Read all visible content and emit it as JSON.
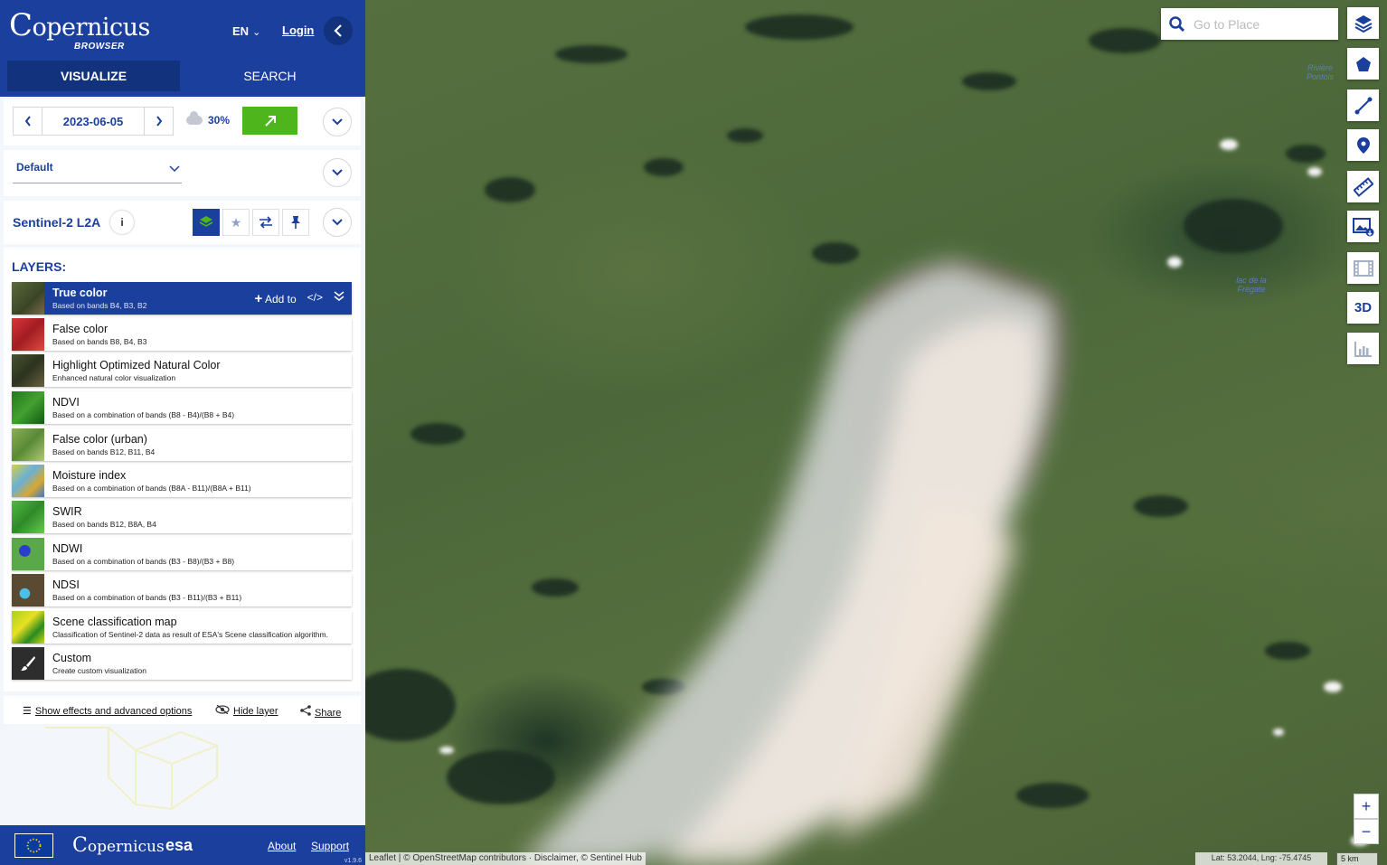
{
  "header": {
    "logo_text": "opernicus",
    "logo_sub": "BROWSER",
    "language": "EN",
    "login_label": "Login",
    "tabs": [
      {
        "label": "VISUALIZE",
        "active": true
      },
      {
        "label": "SEARCH",
        "active": false
      }
    ]
  },
  "date_row": {
    "date": "2023-06-05",
    "cloud_cover": "30%"
  },
  "theme": {
    "selected": "Default"
  },
  "collection": {
    "title": "Sentinel-2 L2A"
  },
  "layers": {
    "heading": "LAYERS:",
    "add_to_label": "Add to",
    "items": [
      {
        "name": "True color",
        "desc": "Based on bands B4, B3, B2",
        "active": true,
        "thumb": "#4a5a30"
      },
      {
        "name": "False color",
        "desc": "Based on bands B8, B4, B3",
        "active": false,
        "thumb": "#c0262a"
      },
      {
        "name": "Highlight Optimized Natural Color",
        "desc": "Enhanced natural color visualization",
        "active": false,
        "thumb": "#3e4a2c"
      },
      {
        "name": "NDVI",
        "desc": "Based on a combination of bands (B8 - B4)/(B8 + B4)",
        "active": false,
        "thumb": "#2f8a2a"
      },
      {
        "name": "False color (urban)",
        "desc": "Based on bands B12, B11, B4",
        "active": false,
        "thumb": "#6fa040"
      },
      {
        "name": "Moisture index",
        "desc": "Based on a combination of bands (B8A - B11)/(B8A + B11)",
        "active": false,
        "thumb": "#b8c24a"
      },
      {
        "name": "SWIR",
        "desc": "Based on bands B12, B8A, B4",
        "active": false,
        "thumb": "#3fa43a"
      },
      {
        "name": "NDWI",
        "desc": "Based on a combination of bands (B3 - B8)/(B3 + B8)",
        "active": false,
        "thumb": "#4f9a4a"
      },
      {
        "name": "NDSI",
        "desc": "Based on a combination of bands (B3 - B11)/(B3 + B11)",
        "active": false,
        "thumb": "#5a4a30"
      },
      {
        "name": "Scene classification map",
        "desc": "Classification of Sentinel-2 data as result of ESA's Scene classification algorithm.",
        "active": false,
        "thumb": "#9acb20"
      },
      {
        "name": "Custom",
        "desc": "Create custom visualization",
        "active": false,
        "thumb": "#2a2a2a"
      }
    ]
  },
  "effects": {
    "show_effects": "Show effects and advanced options",
    "hide_layer": "Hide layer",
    "share": "Share"
  },
  "footer": {
    "copernicus": "opernicus",
    "esa": "esa",
    "about": "About",
    "support": "Support",
    "version": "v1.9.6"
  },
  "map": {
    "search_placeholder": "Go to Place",
    "labels": [
      {
        "text": "Rivière Pontois"
      },
      {
        "text": "lac de la Frégate"
      }
    ],
    "attribution": "Leaflet | © OpenStreetMap contributors · Disclaimer, © Sentinel Hub",
    "coords": "Lat: 53.2044, Lng: -75.4745",
    "scale": "5 km",
    "zoom_in": "+",
    "zoom_out": "−",
    "tool_3d": "3D"
  },
  "colors": {
    "brand_blue": "#1a3f9c",
    "dark_blue": "#13327e",
    "go_green": "#4eb51c"
  }
}
